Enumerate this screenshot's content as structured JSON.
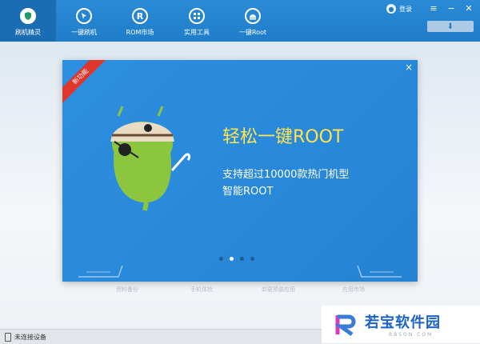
{
  "nav": {
    "items": [
      {
        "label": "刷机精灵",
        "icon": "shield-icon",
        "active": true
      },
      {
        "label": "一键刷机",
        "icon": "cursor-icon"
      },
      {
        "label": "ROM市场",
        "icon": "rom-r-icon"
      },
      {
        "label": "实用工具",
        "icon": "grid-icon"
      },
      {
        "label": "一键Root",
        "icon": "android-icon"
      }
    ],
    "login_label": "登录"
  },
  "window": {
    "menu_glyph": "≡",
    "minimize_glyph": "−",
    "close_glyph": "✕",
    "download_glyph": "⬇"
  },
  "dialog": {
    "ribbon": "新功能",
    "close_glyph": "×",
    "headline": "轻松一键ROOT",
    "line1": "支持超过10000款热门机型",
    "line2": "智能ROOT",
    "carousel": {
      "count": 4,
      "active_index": 1
    }
  },
  "bottom_labels": [
    "资料备份",
    "手机体检",
    "卸载预装应用",
    "应用市场"
  ],
  "status": {
    "text": "未连接设备"
  },
  "watermark": {
    "main": "若宝软件园",
    "sub": "RBSON.COM"
  },
  "colors": {
    "nav_bg": "#1f7dc9",
    "dialog_bg": "#2583d4",
    "headline": "#ffe44d",
    "ribbon": "#e0352b"
  }
}
